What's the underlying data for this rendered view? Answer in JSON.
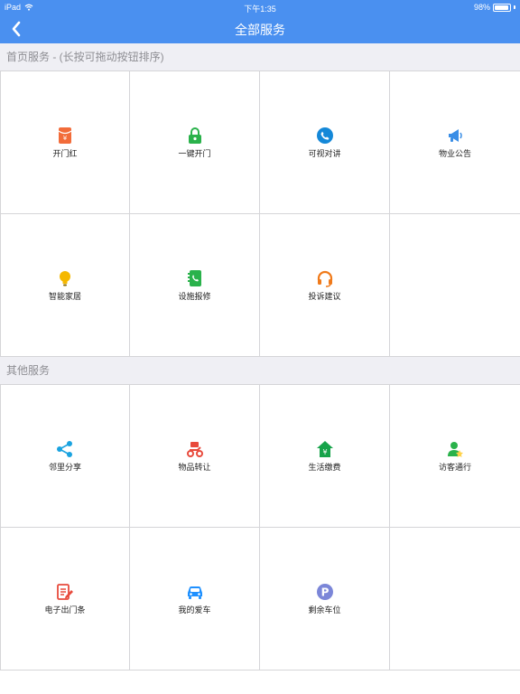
{
  "status": {
    "device": "iPad",
    "time": "下午1:35",
    "battery": "98%"
  },
  "nav": {
    "title": "全部服务"
  },
  "sections": {
    "home": {
      "title": "首页服务 - (长按可拖动按钮排序)",
      "items": [
        {
          "label": "开门红",
          "icon": "red-envelope-icon",
          "color": "#f26c3a"
        },
        {
          "label": "一键开门",
          "icon": "lock-icon",
          "color": "#2ab24b"
        },
        {
          "label": "可视对讲",
          "icon": "phone-icon",
          "color": "#1488d8"
        },
        {
          "label": "物业公告",
          "icon": "megaphone-icon",
          "color": "#3a8ee6"
        },
        {
          "label": "智能家居",
          "icon": "lightbulb-icon",
          "color": "#f5b800"
        },
        {
          "label": "设施报修",
          "icon": "repair-phone-icon",
          "color": "#2ab24b"
        },
        {
          "label": "投诉建议",
          "icon": "headset-icon",
          "color": "#f07a1a"
        }
      ]
    },
    "other": {
      "title": "其他服务",
      "items": [
        {
          "label": "邻里分享",
          "icon": "share-icon",
          "color": "#1aa3e0"
        },
        {
          "label": "物品转让",
          "icon": "scooter-icon",
          "color": "#e84a3c"
        },
        {
          "label": "生活缴费",
          "icon": "house-payment-icon",
          "color": "#16a34a"
        },
        {
          "label": "访客通行",
          "icon": "visitor-icon",
          "color": "#2ab24b"
        },
        {
          "label": "电子出门条",
          "icon": "note-edit-icon",
          "color": "#e84a3c"
        },
        {
          "label": "我的爱车",
          "icon": "car-icon",
          "color": "#1e90ff"
        },
        {
          "label": "剩余车位",
          "icon": "parking-icon",
          "color": "#7b86d8"
        }
      ]
    }
  }
}
